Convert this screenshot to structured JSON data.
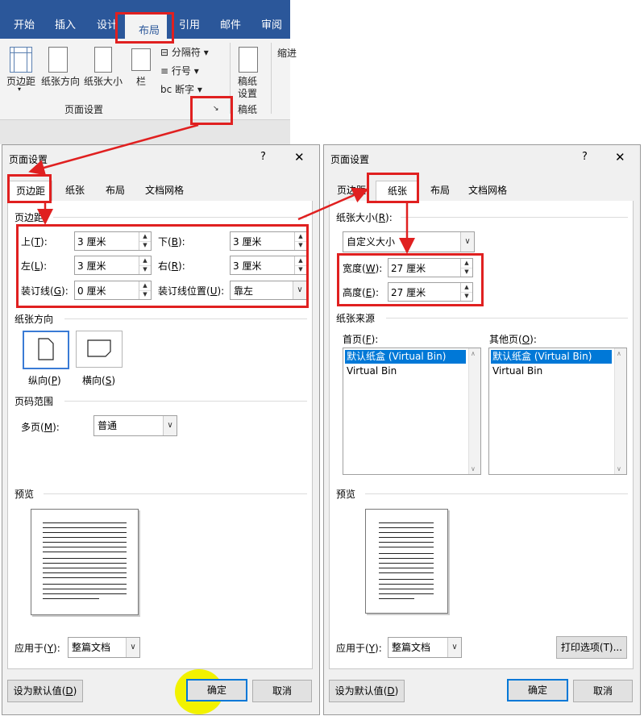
{
  "ribbon": {
    "tabs": [
      "开始",
      "插入",
      "设计",
      "布局",
      "引用",
      "邮件",
      "审阅"
    ],
    "active_tab": "布局",
    "buttons": {
      "margins": "页边距",
      "orientation": "纸张方向",
      "size": "纸张大小",
      "columns": "栏",
      "breaks": "分隔符",
      "line_numbers": "行号",
      "hyphenation": "断字",
      "manuscript": "稿纸设置",
      "manuscript_line1": "稿纸",
      "manuscript_line2": "设置",
      "indent": "缩进"
    },
    "group_page_setup": "页面设置",
    "group_manuscript": "稿纸"
  },
  "dialog_left": {
    "title": "页面设置",
    "help": "?",
    "close": "✕",
    "tabs": [
      "页边距",
      "纸张",
      "布局",
      "文档网格"
    ],
    "active_tab": "页边距",
    "section_margins": "页边距",
    "fields": {
      "top": {
        "label": "上",
        "key": "T",
        "value": "3 厘米"
      },
      "bottom": {
        "label": "下",
        "key": "B",
        "value": "3 厘米"
      },
      "left": {
        "label": "左",
        "key": "L",
        "value": "3 厘米"
      },
      "right": {
        "label": "右",
        "key": "R",
        "value": "3 厘米"
      },
      "gutter": {
        "label": "装订线",
        "key": "G",
        "value": "0 厘米"
      },
      "gutter_pos": {
        "label": "装订线位置",
        "key": "U",
        "value": "靠左"
      }
    },
    "section_orientation": "纸张方向",
    "portrait": {
      "label": "纵向",
      "key": "P"
    },
    "landscape": {
      "label": "横向",
      "key": "S"
    },
    "section_pages": "页码范围",
    "multiple_pages": {
      "label": "多页",
      "key": "M",
      "value": "普通"
    },
    "section_preview": "预览",
    "apply_to": {
      "label": "应用于",
      "key": "Y",
      "value": "整篇文档"
    },
    "set_default": {
      "label": "设为默认值",
      "key": "D"
    },
    "ok": "确定",
    "cancel": "取消"
  },
  "dialog_right": {
    "title": "页面设置",
    "help": "?",
    "close": "✕",
    "tabs": [
      "页边距",
      "纸张",
      "布局",
      "文档网格"
    ],
    "active_tab": "纸张",
    "section_size": {
      "label": "纸张大小",
      "key": "R"
    },
    "size_value": "自定义大小",
    "width": {
      "label": "宽度",
      "key": "W",
      "value": "27 厘米"
    },
    "height": {
      "label": "高度",
      "key": "E",
      "value": "27 厘米"
    },
    "section_source": "纸张来源",
    "first_page": {
      "label": "首页",
      "key": "F"
    },
    "other_pages": {
      "label": "其他页",
      "key": "O"
    },
    "bins": [
      "默认纸盒 (Virtual Bin)",
      "Virtual Bin"
    ],
    "section_preview": "预览",
    "apply_to": {
      "label": "应用于",
      "key": "Y",
      "value": "整篇文档"
    },
    "print_options": "打印选项(T)...",
    "set_default": {
      "label": "设为默认值",
      "key": "D"
    },
    "ok": "确定",
    "cancel": "取消"
  },
  "colors": {
    "annotation": "#e02020",
    "ribbon": "#2b579a",
    "highlight": "#f2f200",
    "selection": "#0078d7"
  }
}
